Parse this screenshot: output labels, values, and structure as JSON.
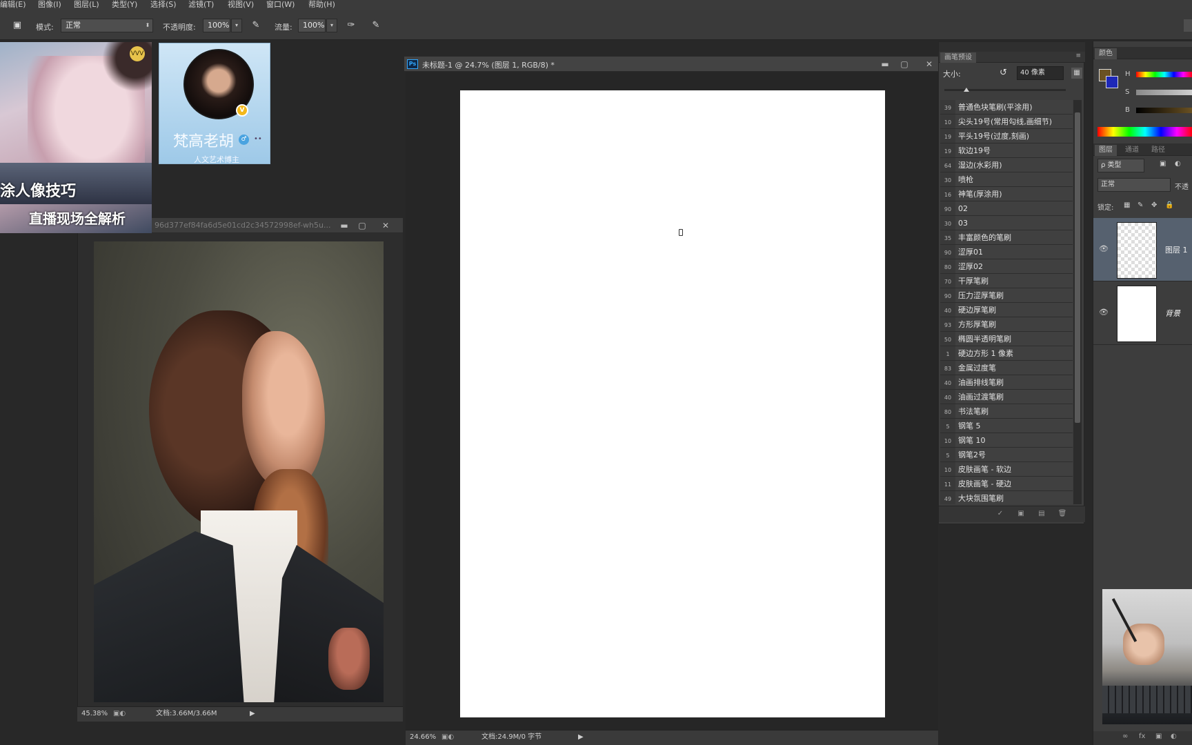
{
  "menubar": {
    "items": [
      "编辑(E)",
      "图像(I)",
      "图层(L)",
      "类型(Y)",
      "选择(S)",
      "滤镜(T)",
      "视图(V)",
      "窗口(W)",
      "帮助(H)"
    ]
  },
  "options": {
    "mode_label": "模式:",
    "mode_value": "正常",
    "opacity_label": "不透明度:",
    "opacity_value": "100%",
    "flow_label": "流量:",
    "flow_value": "100%"
  },
  "promo": {
    "line1": "涂人像技巧",
    "line2": "直播现场全解析",
    "logo": "VVV"
  },
  "avatar_card": {
    "name": "梵高老胡",
    "subtitle": "人文艺术博主"
  },
  "ref_window": {
    "title": "96d377ef84fa6d5e01cd2c34572998ef-wh5u...",
    "zoom": "45.38%",
    "doc": "文档:3.66M/3.66M"
  },
  "main_window": {
    "title": "未标题-1 @ 24.7% (图层 1, RGB/8) *",
    "zoom": "24.66%",
    "doc": "文档:24.9M/0 字节"
  },
  "brush_panel": {
    "tab": "画笔预设",
    "size_label": "大小:",
    "size_value": "40 像素",
    "brushes": [
      {
        "size": "39",
        "name": "普通色块笔刷(平涂用)"
      },
      {
        "size": "10",
        "name": "尖头19号(常用勾线,画细节)"
      },
      {
        "size": "19",
        "name": "平头19号(过度,刻画)"
      },
      {
        "size": "19",
        "name": "软边19号"
      },
      {
        "size": "64",
        "name": "湿边(水彩用)"
      },
      {
        "size": "30",
        "name": "喷枪"
      },
      {
        "size": "16",
        "name": "神笔(厚涂用)"
      },
      {
        "size": "90",
        "name": "02"
      },
      {
        "size": "30",
        "name": "03"
      },
      {
        "size": "35",
        "name": "丰富颜色的笔刷"
      },
      {
        "size": "90",
        "name": "涩厚01"
      },
      {
        "size": "80",
        "name": "涩厚02"
      },
      {
        "size": "70",
        "name": "干厚笔刷"
      },
      {
        "size": "90",
        "name": "压力涩厚笔刷"
      },
      {
        "size": "40",
        "name": "硬边厚笔刷"
      },
      {
        "size": "93",
        "name": "方形厚笔刷"
      },
      {
        "size": "50",
        "name": "椭圆半透明笔刷"
      },
      {
        "size": "1",
        "name": "硬边方形 1 像素"
      },
      {
        "size": "83",
        "name": "金属过度笔"
      },
      {
        "size": "40",
        "name": "油画排线笔刷"
      },
      {
        "size": "40",
        "name": "油画过渡笔刷"
      },
      {
        "size": "80",
        "name": "书法笔刷"
      },
      {
        "size": "5",
        "name": "钢笔 5"
      },
      {
        "size": "10",
        "name": "钢笔 10"
      },
      {
        "size": "5",
        "name": "钢笔2号"
      },
      {
        "size": "10",
        "name": "皮肤画笔 - 软边"
      },
      {
        "size": "11",
        "name": "皮肤画笔 - 硬边"
      },
      {
        "size": "49",
        "name": "大块氛围笔刷"
      }
    ]
  },
  "color_panel": {
    "tab": "颜色",
    "h": "H",
    "s": "S",
    "b": "B",
    "fg_color": "#6b5223",
    "bg_color": "#1e28b8"
  },
  "layers_panel": {
    "tabs": [
      "图层",
      "通道",
      "路径"
    ],
    "filter_value": "ρ 类型",
    "blend_value": "正常",
    "opacity_label": "不透",
    "lock_label": "锁定:",
    "layers": [
      {
        "name": "图层 1"
      },
      {
        "name": "背景"
      }
    ]
  }
}
